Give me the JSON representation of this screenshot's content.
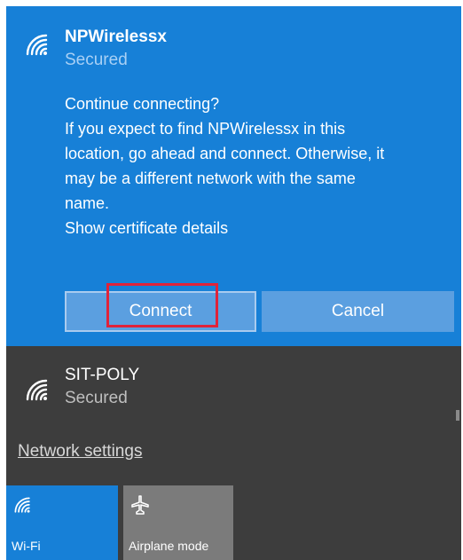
{
  "selected_network": {
    "name": "NPWirelessx",
    "status": "Secured",
    "prompt_lines": [
      "Continue connecting?",
      "If you expect to find NPWirelessx in this",
      "location, go ahead and connect. Otherwise, it",
      "may be a different network with the same",
      "name.",
      "Show certificate details"
    ],
    "connect_label": "Connect",
    "cancel_label": "Cancel"
  },
  "other_network": {
    "name": "SIT-POLY",
    "status": "Secured"
  },
  "network_settings_label": "Network settings",
  "quick_actions": [
    {
      "label": "Wi-Fi",
      "icon": "wifi-icon",
      "active": true
    },
    {
      "label": "Airplane mode",
      "icon": "airplane-icon",
      "active": false
    }
  ],
  "colors": {
    "accent": "#1780d7",
    "panel": "#3d3d3d",
    "button": "#5b9fe0",
    "highlight": "#e0233a",
    "tile_inactive": "#7b7b7b"
  }
}
